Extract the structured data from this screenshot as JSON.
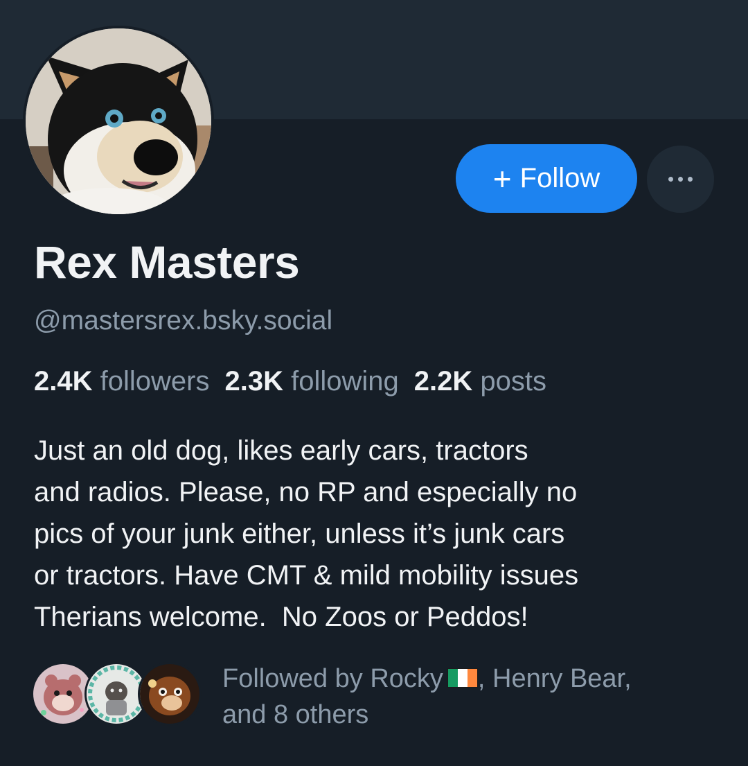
{
  "profile": {
    "display_name": "Rex Masters",
    "handle": "@mastersrex.bsky.social",
    "avatar_icon": "husky-fursuit-avatar"
  },
  "actions": {
    "follow_label": "Follow",
    "follow_icon": "plus-icon",
    "more_icon": "ellipsis-icon"
  },
  "stats": {
    "followers_count": "2.4K",
    "followers_label": "followers",
    "following_count": "2.3K",
    "following_label": "following",
    "posts_count": "2.2K",
    "posts_label": "posts"
  },
  "bio": {
    "lines": [
      "Just an old dog, likes early cars, tractors",
      "and radios. Please, no RP and especially no",
      "pics of your junk either, unless it’s junk cars",
      "or tractors. Have CMT & mild mobility issues",
      "Therians welcome.  No Zoos or Peddos!"
    ]
  },
  "followed_by": {
    "prefix": "Followed by Rocky",
    "flag_icon": "ireland-flag-icon",
    "middle": ", Henry Bear,",
    "suffix": "and 8 others"
  },
  "colors": {
    "background": "#161e27",
    "banner": "#1f2a35",
    "accent": "#1d83f0",
    "muted_text": "#8d9cab",
    "primary_text": "#f1f3f5"
  }
}
